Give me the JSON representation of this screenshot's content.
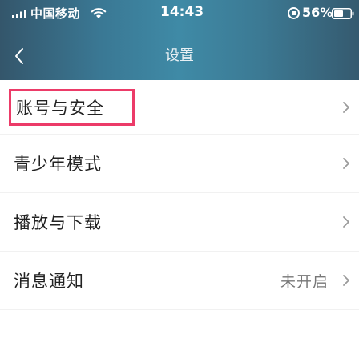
{
  "status_bar": {
    "carrier": "中国移动",
    "time": "14:43",
    "battery_percent": "56%"
  },
  "header": {
    "title": "设置",
    "back_icon": "chevron-left-icon"
  },
  "settings": {
    "items": [
      {
        "label": "账号与安全",
        "value": "",
        "highlighted": true
      },
      {
        "label": "青少年模式",
        "value": ""
      },
      {
        "label": "播放与下载",
        "value": ""
      },
      {
        "label": "消息通知",
        "value": "未开启"
      }
    ]
  },
  "colors": {
    "header_gradient_mid": "#3f8aa6",
    "highlight_border": "#ec3b68",
    "chevron": "#9a9a9a"
  }
}
